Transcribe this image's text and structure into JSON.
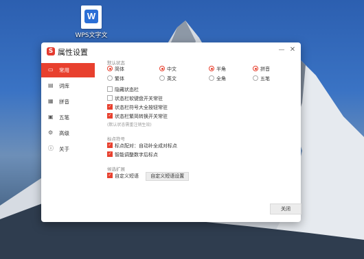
{
  "desktop": {
    "icon_label": "WPS文字文"
  },
  "dialog": {
    "title": "属性设置",
    "logo_letter": "S",
    "minimize": "—",
    "close": "✕",
    "close_button": "关闭"
  },
  "sidebar": {
    "items": [
      {
        "label": "常用",
        "icon": "monitor-icon",
        "active": true
      },
      {
        "label": "词库",
        "icon": "dictionary-icon",
        "active": false
      },
      {
        "label": "拼音",
        "icon": "pinyin-icon",
        "active": false
      },
      {
        "label": "五笔",
        "icon": "wubi-icon",
        "active": false
      },
      {
        "label": "高级",
        "icon": "gear-icon",
        "active": false
      },
      {
        "label": "关于",
        "icon": "info-icon",
        "active": false
      }
    ]
  },
  "default_state": {
    "title": "默认状态",
    "row1": [
      "简体",
      "中文",
      "半角",
      "拼音"
    ],
    "row2": [
      "繁体",
      "英文",
      "全角",
      "五笔"
    ],
    "checks": [
      {
        "label": "隐藏状态栏",
        "checked": false
      },
      {
        "label": "状态栏软键盘开关常驻",
        "checked": false
      },
      {
        "label": "状态栏符号大全按钮常驻",
        "checked": true
      },
      {
        "label": "状态栏繁简转换开关常驻",
        "checked": true
      }
    ],
    "note": "(默认状态需重注销生效)"
  },
  "punctuation": {
    "title": "标点符号",
    "checks": [
      {
        "label": "标点配对：自动补全成对标点",
        "checked": true
      },
      {
        "label": "智能调整数字后标点",
        "checked": true
      }
    ]
  },
  "candidate": {
    "title": "候选扩展",
    "check_label": "自定义短语",
    "button_label": "自定义短语设置"
  },
  "colors": {
    "accent": "#e8402e"
  }
}
